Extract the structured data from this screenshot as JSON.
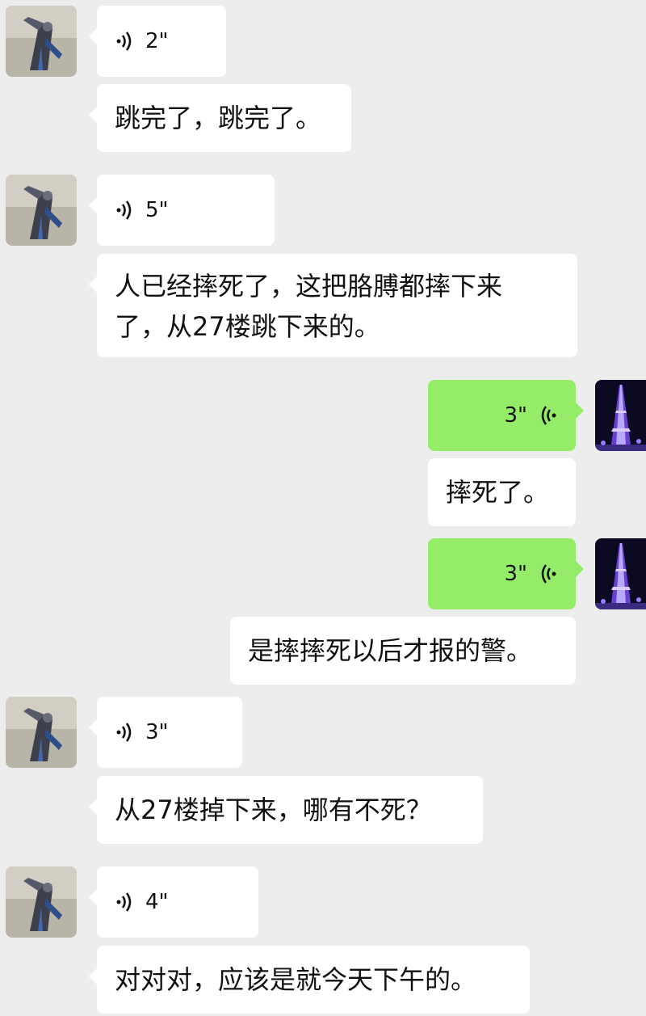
{
  "conversation": {
    "messages": [
      {
        "id": "m1",
        "side": "left",
        "type": "voice",
        "duration": "2\""
      },
      {
        "id": "m2",
        "side": "left",
        "type": "text",
        "text": "跳完了，跳完了。"
      },
      {
        "id": "m3",
        "side": "left",
        "type": "voice",
        "duration": "5\""
      },
      {
        "id": "m4",
        "side": "left",
        "type": "text",
        "lines": [
          "人已经摔死了，这把胳膊都摔下来",
          "了，从27楼跳下来的。"
        ]
      },
      {
        "id": "m5",
        "side": "right",
        "type": "voice",
        "duration": "3\""
      },
      {
        "id": "m6",
        "side": "right",
        "type": "text",
        "text": "摔死了。"
      },
      {
        "id": "m7",
        "side": "right",
        "type": "voice",
        "duration": "3\""
      },
      {
        "id": "m8",
        "side": "right",
        "type": "text",
        "text": "是摔摔死以后才报的警。"
      },
      {
        "id": "m9",
        "side": "left",
        "type": "voice",
        "duration": "3\""
      },
      {
        "id": "m10",
        "side": "left",
        "type": "text",
        "text": "从27楼掉下来，哪有不死？"
      },
      {
        "id": "m11",
        "side": "left",
        "type": "voice",
        "duration": "4\""
      },
      {
        "id": "m12",
        "side": "left",
        "type": "text",
        "text": "对对对，应该是就今天下午的。"
      }
    ]
  },
  "colors": {
    "background": "#ededed",
    "incoming_bubble": "#ffffff",
    "outgoing_bubble": "#95ec69",
    "text": "#111111"
  },
  "icons": {
    "incoming_voice": "voice-wave-right-icon",
    "outgoing_voice": "voice-wave-left-icon",
    "contact_avatar": "robot-figure-avatar",
    "self_avatar": "eiffel-tower-night-avatar"
  }
}
